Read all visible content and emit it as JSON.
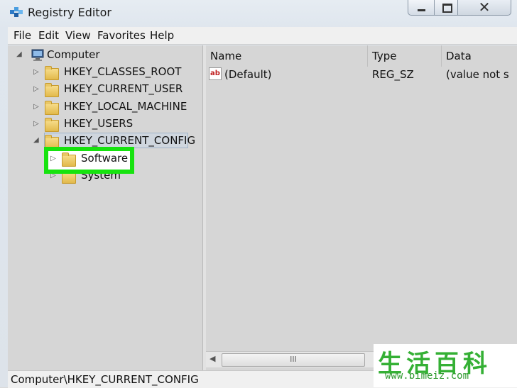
{
  "window": {
    "title": "Registry Editor"
  },
  "titlebar": {
    "minimize": "‒",
    "close": "✕"
  },
  "menu": [
    "File",
    "Edit",
    "View",
    "Favorites",
    "Help"
  ],
  "tree": {
    "root": "Computer",
    "hives": [
      "HKEY_CLASSES_ROOT",
      "HKEY_CURRENT_USER",
      "HKEY_LOCAL_MACHINE",
      "HKEY_USERS",
      "HKEY_CURRENT_CONFIG"
    ],
    "children": [
      "Software",
      "System"
    ],
    "expanded_glyph": "◢",
    "collapsed_glyph": "▷"
  },
  "list": {
    "columns": [
      "Name",
      "Type",
      "Data"
    ],
    "rows": [
      {
        "name": "(Default)",
        "type": "REG_SZ",
        "data": "(value not s"
      }
    ],
    "value_icon_text": "ab"
  },
  "scrollbar": {
    "left": "◀",
    "thumb": "III"
  },
  "status": "Computer\\HKEY_CURRENT_CONFIG",
  "watermark": {
    "chars": "生活百科",
    "url": "www.bimeiz.com"
  },
  "colors": {
    "highlight": "#17e30f",
    "watermark": "#35b035"
  }
}
